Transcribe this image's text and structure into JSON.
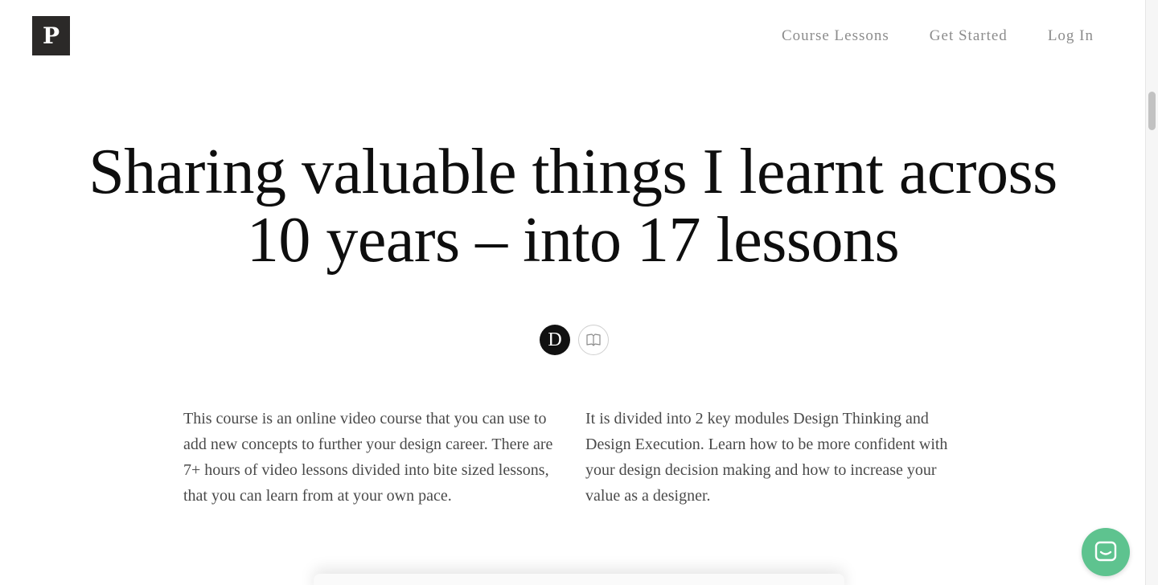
{
  "header": {
    "logo_letter": "P",
    "nav": [
      {
        "label": "Course Lessons"
      },
      {
        "label": "Get Started"
      },
      {
        "label": "Log In"
      }
    ]
  },
  "hero": {
    "title_line1": "Sharing valuable things I learnt across",
    "title_line2": "10 years – into 17 lessons"
  },
  "icons": {
    "author_letter": "D",
    "author_icon": "author-avatar-icon",
    "book_icon": "open-book-icon"
  },
  "intro": {
    "left": "This course is an online video course that you can use to add new concepts to further your design career. There are 7+ hours of video lessons divided into bite sized lessons, that you can learn from at your own pace.",
    "right": "It is divided into 2 key modules Design Thinking and Design Execution. Learn how to be more confident with your design decision making and how to increase your value as a designer."
  },
  "chat": {
    "icon": "chat-icon",
    "color": "#5ec38f"
  },
  "colors": {
    "logo_bg": "#2b2928",
    "nav_text": "#8c8c8c",
    "body_text": "#4a4a4a"
  }
}
